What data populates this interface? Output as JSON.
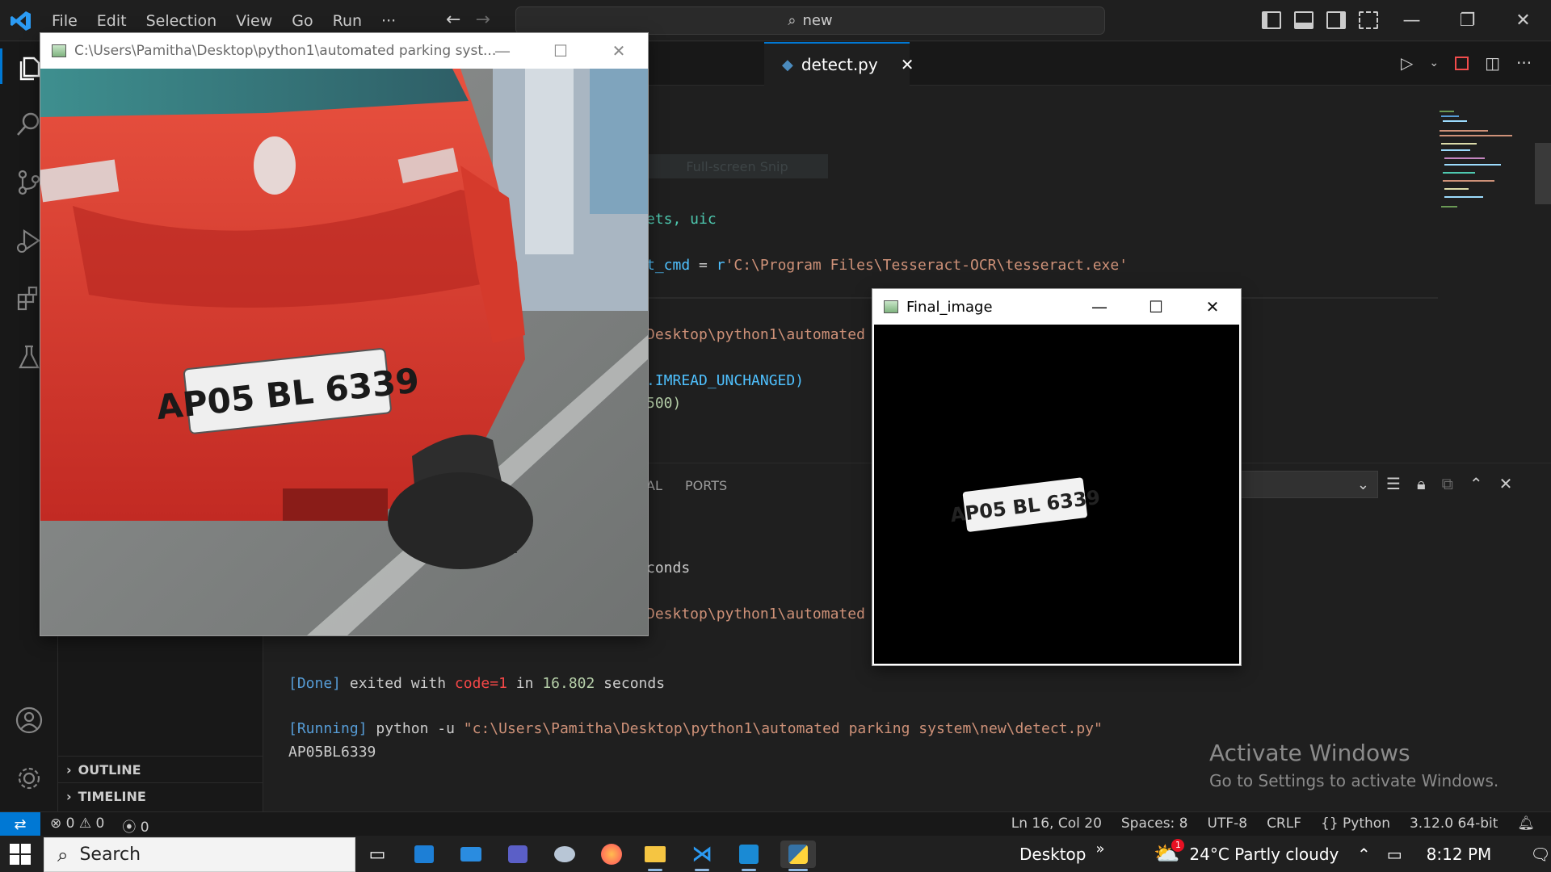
{
  "vscode": {
    "menu": [
      "File",
      "Edit",
      "Selection",
      "View",
      "Go",
      "Run",
      "···"
    ],
    "search_text": "new",
    "active_tab": "detect.py",
    "code": {
      "line1": "ets, uic",
      "line2_var": "t_cmd",
      "line2_eq": " = ",
      "line2_prefix": "r",
      "line2_str": "'C:\\Program Files\\Tesseract-OCR\\tesseract.exe'",
      "line3": "Desktop\\python1\\automated",
      "line4": ".IMREAD_UNCHANGED)",
      "line5": "500)"
    },
    "snip_tooltip": "Full-screen Snip",
    "panel": {
      "tab_partial": "AL",
      "tab_ports": "PORTS",
      "out_partial1": "conds",
      "out_partial2": "Desktop\\python1\\automated",
      "done_tag": "[Done]",
      "done_text1": " exited with ",
      "done_code": "code=1",
      "done_text2": " in ",
      "done_secs": "16.802",
      "done_text3": " seconds",
      "running_tag": "[Running]",
      "running_cmd": " python -u ",
      "running_path": "\"c:\\Users\\Pamitha\\Desktop\\python1\\automated parking system\\new\\detect.py\"",
      "result": "AP05BL6339"
    },
    "sidebar": {
      "outline": "OUTLINE",
      "timeline": "TIMELINE"
    },
    "statusbar": {
      "errors": "0",
      "warnings": "0",
      "ports": "0",
      "position": "Ln 16, Col 20",
      "spaces": "Spaces: 8",
      "encoding": "UTF-8",
      "eol": "CRLF",
      "language": "Python",
      "interpreter": "3.12.0 64-bit"
    },
    "watermark": {
      "title": "Activate Windows",
      "subtitle": "Go to Settings to activate Windows."
    }
  },
  "car_window": {
    "title": "C:\\Users\\Pamitha\\Desktop\\python1\\automated parking syst...",
    "plate_text": "AP05 BL 6339"
  },
  "final_window": {
    "title": "Final_image",
    "plate_text": "AP05 BL 6339"
  },
  "taskbar": {
    "search_placeholder": "Search",
    "desktop_label": "Desktop",
    "chevron": "»",
    "weather": "24°C  Partly cloudy",
    "weather_badge": "1",
    "time": "8:12 PM"
  }
}
